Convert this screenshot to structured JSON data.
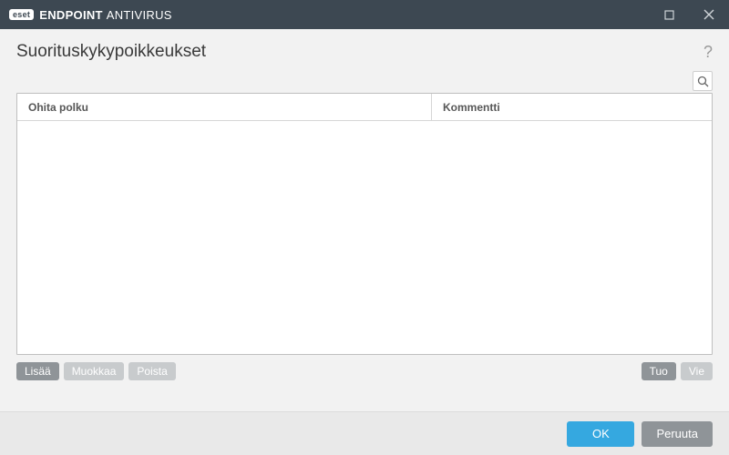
{
  "titlebar": {
    "badge": "eset",
    "brand_bold": "ENDPOINT",
    "brand_light": "ANTIVIRUS"
  },
  "page": {
    "title": "Suorituskykypoikkeukset",
    "help": "?"
  },
  "table": {
    "columns": [
      "Ohita polku",
      "Kommentti"
    ],
    "rows": []
  },
  "actions": {
    "add": "Lisää",
    "edit": "Muokkaa",
    "delete": "Poista",
    "import": "Tuo",
    "export": "Vie"
  },
  "footer": {
    "ok": "OK",
    "cancel": "Peruuta"
  },
  "colors": {
    "titlebar": "#3d4852",
    "primary": "#35a8e0",
    "secondary": "#8f9498",
    "disabled": "#c8cbcd"
  }
}
